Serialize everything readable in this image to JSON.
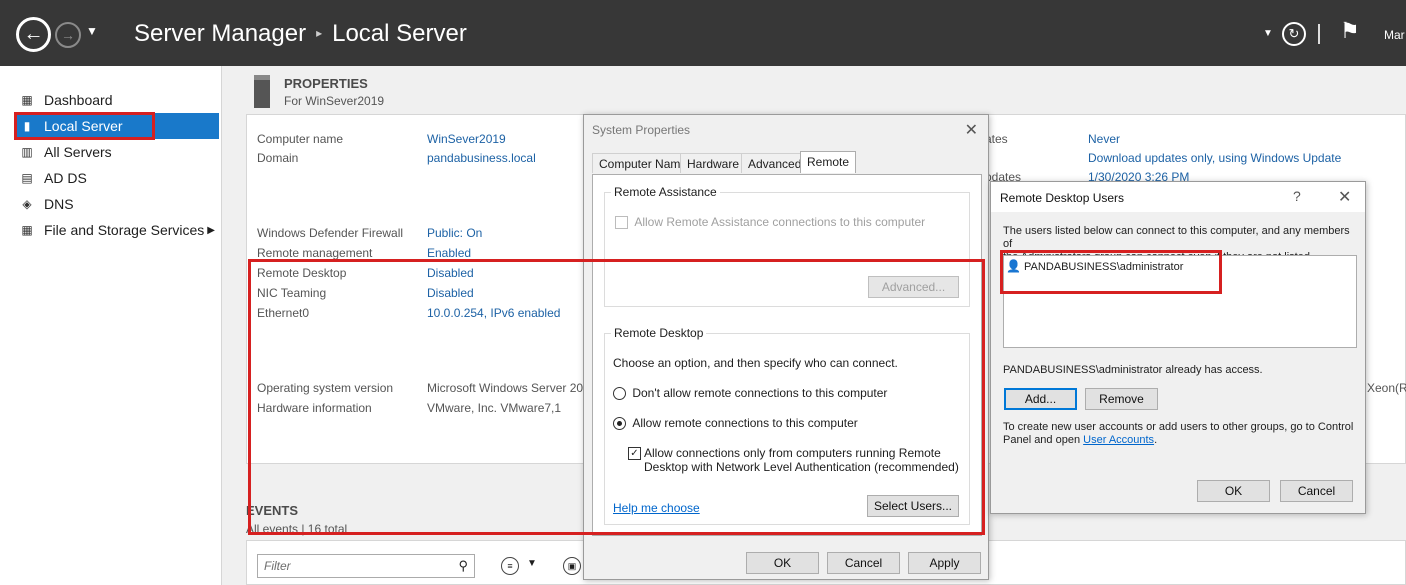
{
  "titlebar": {
    "app_name": "Server Manager",
    "separator": "▸",
    "page": "Local Server",
    "manage_label": "Mar"
  },
  "sidebar": {
    "items": [
      {
        "label": "Dashboard",
        "icon": "dashboard-icon"
      },
      {
        "label": "Local Server",
        "icon": "server-icon"
      },
      {
        "label": "All Servers",
        "icon": "servers-icon"
      },
      {
        "label": "AD DS",
        "icon": "ad-ds-icon"
      },
      {
        "label": "DNS",
        "icon": "dns-icon"
      },
      {
        "label": "File and Storage Services",
        "icon": "storage-icon"
      }
    ]
  },
  "properties": {
    "title": "PROPERTIES",
    "subtitle": "For WinSever2019",
    "rows": [
      {
        "label": "Computer name",
        "value": "WinSever2019"
      },
      {
        "label": "Domain",
        "value": "pandabusiness.local"
      },
      {
        "label": "Windows Defender Firewall",
        "value": "Public: On"
      },
      {
        "label": "Remote management",
        "value": "Enabled"
      },
      {
        "label": "Remote Desktop",
        "value": "Disabled"
      },
      {
        "label": "NIC Teaming",
        "value": "Disabled"
      },
      {
        "label": "Ethernet0",
        "value": "10.0.0.254, IPv6 enabled"
      },
      {
        "label": "Operating system version",
        "value": "Microsoft Windows Server 20"
      },
      {
        "label": "Hardware information",
        "value": "VMware, Inc. VMware7,1"
      }
    ],
    "right_col": {
      "label_a": "ates",
      "value_a": "Never",
      "value_b": "Download updates only, using Windows Update",
      "label_c": "pdates",
      "value_c": "1/30/2020 3:26 PM",
      "value_d": "Xeon(R"
    }
  },
  "events": {
    "title": "EVENTS",
    "subtitle": "All events | 16 total",
    "filter_placeholder": "Filter"
  },
  "system_properties": {
    "title": "System Properties",
    "tabs": [
      "Computer Name",
      "Hardware",
      "Advanced",
      "Remote"
    ],
    "selected_tab": "Remote",
    "remote_assistance": {
      "group_label": "Remote Assistance",
      "checkbox_label": "Allow Remote Assistance connections to this computer",
      "advanced_button": "Advanced..."
    },
    "remote_desktop": {
      "group_label": "Remote Desktop",
      "instruction": "Choose an option, and then specify who can connect.",
      "option_deny": "Don't allow remote connections to this computer",
      "option_allow": "Allow remote connections to this computer",
      "nla_line1": "Allow connections only from computers running Remote",
      "nla_line2": "Desktop with Network Level Authentication (recommended)",
      "help_link": "Help me choose",
      "select_users_button": "Select Users..."
    },
    "ok_button": "OK",
    "cancel_button": "Cancel",
    "apply_button": "Apply"
  },
  "rdu_dialog": {
    "title": "Remote Desktop Users",
    "help": "?",
    "description_line1": "The users listed below can connect to this computer, and any members of",
    "description_line2": "the Administrators group can connect even if they are not listed.",
    "users": [
      "PANDABUSINESS\\administrator"
    ],
    "access_note": "PANDABUSINESS\\administrator already has access.",
    "add_button": "Add...",
    "remove_button": "Remove",
    "footer_line1": "To create new user accounts or add users to other groups, go to Control",
    "footer_line2_prefix": "Panel and open ",
    "footer_link": "User Accounts",
    "footer_suffix": ".",
    "ok_button": "OK",
    "cancel_button": "Cancel"
  },
  "colors": {
    "accent": "#1979ca",
    "highlight_box": "#d62020",
    "link": "#1d62a5"
  }
}
